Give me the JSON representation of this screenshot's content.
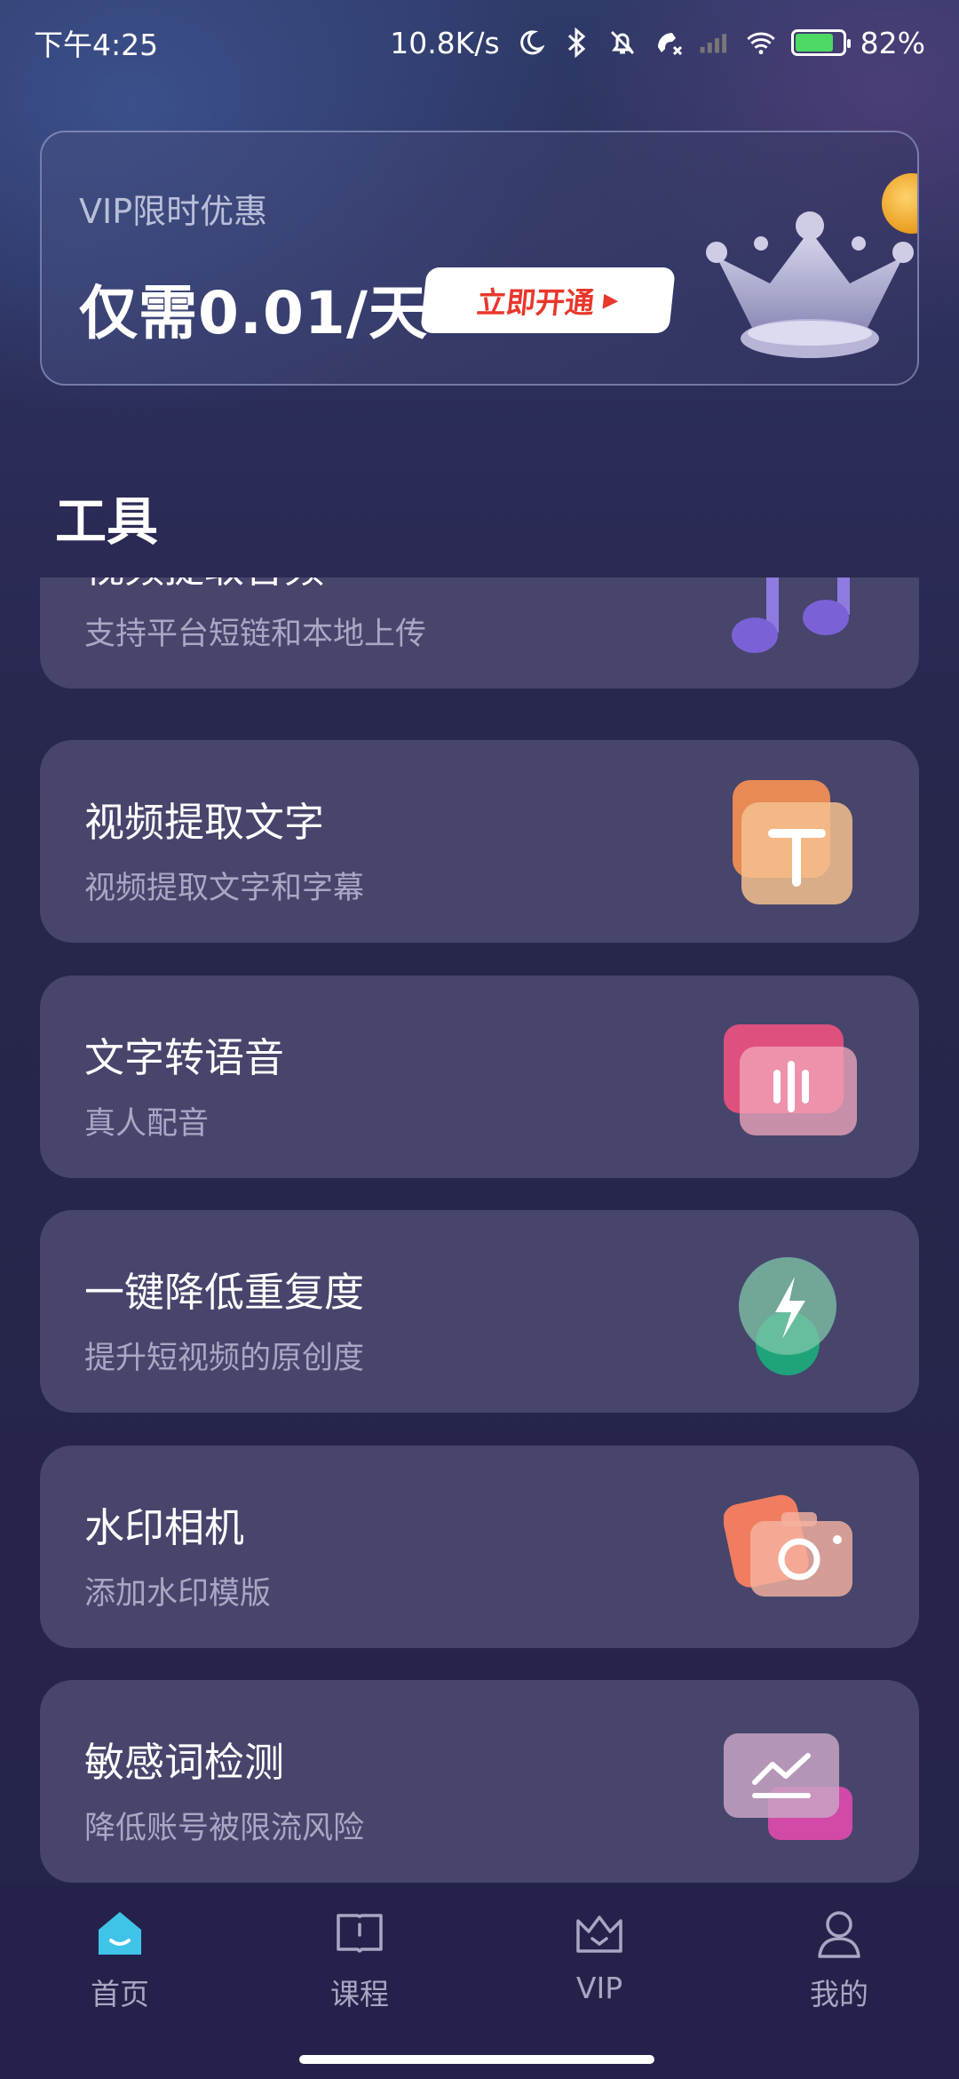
{
  "status_bar": {
    "time": "下午4:25",
    "network_speed": "10.8K/s",
    "battery_percent_label": "82%",
    "battery_level": 0.82,
    "icons": [
      "moon-icon",
      "bluetooth-icon",
      "bell-off-icon",
      "call-missed-icon",
      "signal-icon",
      "wifi-icon",
      "battery-icon"
    ]
  },
  "vip_banner": {
    "title": "VIP限时优惠",
    "price": "仅需0.01/天",
    "button_label": "立即开通",
    "icon": "crown-icon"
  },
  "section_title": "工具",
  "tools": [
    {
      "title": "视频提取音频",
      "subtitle": "支持平台短链和本地上传",
      "icon": "music-note-icon"
    },
    {
      "title": "视频提取文字",
      "subtitle": "视频提取文字和字幕",
      "icon": "text-t-icon"
    },
    {
      "title": "文字转语音",
      "subtitle": "真人配音",
      "icon": "voice-wave-icon"
    },
    {
      "title": "一键降低重复度",
      "subtitle": "提升短视频的原创度",
      "icon": "lightning-icon"
    },
    {
      "title": "水印相机",
      "subtitle": "添加水印模版",
      "icon": "camera-icon"
    },
    {
      "title": "敏感词检测",
      "subtitle": "降低账号被限流风险",
      "icon": "trend-chart-icon"
    }
  ],
  "bottom_nav": [
    {
      "label": "首页",
      "icon": "home-icon",
      "active": true
    },
    {
      "label": "课程",
      "icon": "book-icon",
      "active": false
    },
    {
      "label": "VIP",
      "icon": "vip-crown-icon",
      "active": false
    },
    {
      "label": "我的",
      "icon": "person-icon",
      "active": false
    }
  ],
  "colors": {
    "card_bg": "#47456c",
    "accent_red": "#e8372c",
    "subtitle": "#a9a7c4"
  }
}
